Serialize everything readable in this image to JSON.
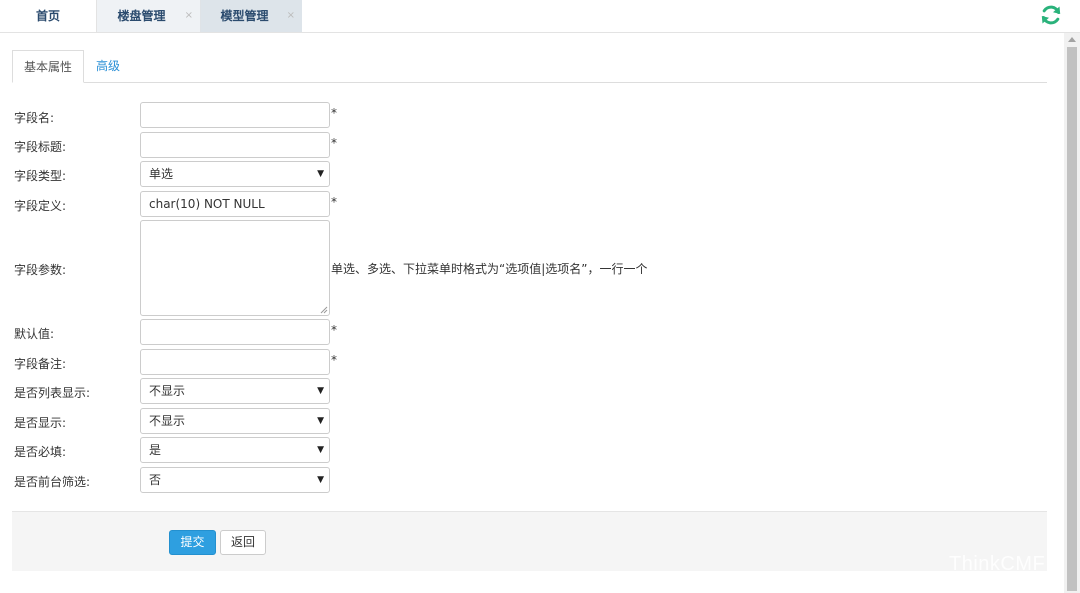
{
  "topbar": {
    "tabs": [
      {
        "label": "首页"
      },
      {
        "label": "楼盘管理",
        "close": "×"
      },
      {
        "label": "模型管理",
        "close": "×"
      }
    ],
    "accent": "#2ab27b"
  },
  "inner_tabs": {
    "active": "基本属性",
    "other": "高级"
  },
  "form": {
    "field_name": {
      "label": "字段名:",
      "value": "",
      "required": "*"
    },
    "field_title": {
      "label": "字段标题:",
      "value": "",
      "required": "*"
    },
    "field_type": {
      "label": "字段类型:",
      "value": "单选"
    },
    "field_def": {
      "label": "字段定义:",
      "value": "char(10) NOT NULL",
      "required": "*"
    },
    "field_params": {
      "label": "字段参数:",
      "value": "",
      "hint": "单选、多选、下拉菜单时格式为“选项值|选项名”，一行一个"
    },
    "default_value": {
      "label": "默认值:",
      "value": "",
      "required": "*"
    },
    "field_note": {
      "label": "字段备注:",
      "value": "",
      "required": "*"
    },
    "list_display": {
      "label": "是否列表显示:",
      "value": "不显示"
    },
    "display": {
      "label": "是否显示:",
      "value": "不显示"
    },
    "required_field": {
      "label": "是否必填:",
      "value": "是"
    },
    "front_filter": {
      "label": "是否前台筛选:",
      "value": "否"
    }
  },
  "actions": {
    "submit": "提交",
    "back": "返回"
  },
  "watermark": "ThinkCMF",
  "colors": {
    "primary": "#2e9fe0",
    "link": "#2a8fd6",
    "refresh": "#2ab27b"
  }
}
